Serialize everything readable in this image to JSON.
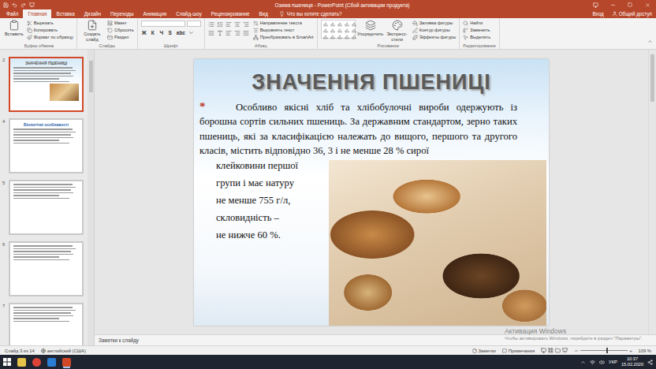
{
  "window": {
    "title": "Озима пшениця - PowerPoint (Сбой активации продукта)"
  },
  "tabs": [
    {
      "label": "Файл",
      "selected": false
    },
    {
      "label": "Главная",
      "selected": true
    },
    {
      "label": "Вставка",
      "selected": false
    },
    {
      "label": "Дизайн",
      "selected": false
    },
    {
      "label": "Переходы",
      "selected": false
    },
    {
      "label": "Анимация",
      "selected": false
    },
    {
      "label": "Слайд-шоу",
      "selected": false
    },
    {
      "label": "Рецензирование",
      "selected": false
    },
    {
      "label": "Вид",
      "selected": false
    }
  ],
  "search": {
    "placeholder": "Что вы хотите сделать?"
  },
  "account": {
    "signin": "Вход",
    "share": "Общий доступ"
  },
  "ribbon_groups": [
    {
      "label": "Буфер обмена",
      "kind": "clipboard",
      "commands": [
        {
          "label": "Вставить",
          "kind": "large"
        },
        {
          "label": "Вырезать",
          "kind": "small"
        },
        {
          "label": "Копировать",
          "kind": "small"
        },
        {
          "label": "Формат по образцу",
          "kind": "small"
        }
      ]
    },
    {
      "label": "Слайды",
      "kind": "slides",
      "commands": [
        {
          "label": "Создать слайд",
          "kind": "large"
        },
        {
          "label": "Макет",
          "kind": "small"
        },
        {
          "label": "Сбросить",
          "kind": "small"
        },
        {
          "label": "Раздел",
          "kind": "small"
        }
      ]
    },
    {
      "label": "Шрифт",
      "kind": "font",
      "commands": [
        {
          "label": "Ж",
          "kind": "key"
        },
        {
          "label": "К",
          "kind": "key"
        },
        {
          "label": "Ч",
          "kind": "key"
        },
        {
          "label": "S",
          "kind": "key"
        },
        {
          "label": "abc",
          "kind": "key"
        }
      ]
    },
    {
      "label": "Абзац",
      "kind": "paragraph",
      "commands": [
        {
          "label": "Направление текста",
          "kind": "small"
        },
        {
          "label": "Выровнять текст",
          "kind": "small"
        },
        {
          "label": "Преобразовать в SmartArt",
          "kind": "small"
        }
      ]
    },
    {
      "label": "Рисование",
      "kind": "drawing",
      "commands": [
        {
          "label": "Упорядочить",
          "kind": "large"
        },
        {
          "label": "Экспресс-стили",
          "kind": "large"
        },
        {
          "label": "Заливка фигуры",
          "kind": "small"
        },
        {
          "label": "Контур фигуры",
          "kind": "small"
        },
        {
          "label": "Эффекты фигуры",
          "kind": "small"
        }
      ]
    },
    {
      "label": "Редактирование",
      "kind": "editing",
      "commands": [
        {
          "label": "Найти",
          "kind": "small"
        },
        {
          "label": "Заменить",
          "kind": "small"
        },
        {
          "label": "Выделить",
          "kind": "small"
        }
      ]
    }
  ],
  "thumbnails": [
    {
      "number": "2",
      "title": "ЗНАЧЕННЯ ПШЕНИЦІ",
      "selected": true
    },
    {
      "number": "4",
      "title": "Біологічні особливості",
      "selected": false
    },
    {
      "number": "5",
      "selected": false
    },
    {
      "number": "6",
      "selected": false
    },
    {
      "number": "7",
      "selected": false
    }
  ],
  "slide": {
    "title": "ЗНАЧЕННЯ ПШЕНИЦІ",
    "bullet": "*",
    "paragraph": "Особливо якісні хліб та хлібобулочні вироби одержують із борошна сортів сильних пшениць. За державним стандартом, зерно таких пшениць, які за класифікацією належать до вищого, першого та другого класів, містить відповідно 36, 3 і не менше 28 % сирої",
    "side_lines": [
      "клейковини першої",
      "групи і має натуру",
      "не менше 755 г/л,",
      "скловидність –",
      "не нижче 60 %."
    ]
  },
  "notes": {
    "placeholder": "Заметки к слайду"
  },
  "status_bar": {
    "slide": "Слайд 3 из 14",
    "language": "английский (США)",
    "notes": "Заметки",
    "comments": "Примечания",
    "zoom": "109 %",
    "zoom_level": 0.55
  },
  "watermark": {
    "title": "Активация Windows",
    "text": "Чтобы активировать Windows, перейдите в раздел \"Параметры\"."
  },
  "taskbar": {
    "language": "УКР",
    "time": "10:37",
    "date": "15.02.2020"
  }
}
